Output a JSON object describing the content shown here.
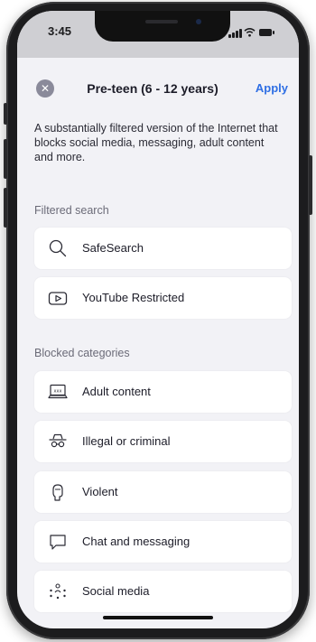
{
  "status": {
    "time": "3:45"
  },
  "header": {
    "title": "Pre-teen (6 - 12 years)",
    "apply_label": "Apply",
    "close_glyph": "✕"
  },
  "description": "A substantially filtered version of the Internet that blocks social media, messaging, adult content and more.",
  "filtered_search": {
    "heading": "Filtered search",
    "items": [
      {
        "label": "SafeSearch",
        "icon": "search-icon"
      },
      {
        "label": "YouTube Restricted",
        "icon": "play-icon"
      }
    ]
  },
  "blocked": {
    "heading": "Blocked categories",
    "items": [
      {
        "label": "Adult content",
        "icon": "xxx-laptop-icon"
      },
      {
        "label": "Illegal or criminal",
        "icon": "spy-icon"
      },
      {
        "label": "Violent",
        "icon": "fist-icon"
      },
      {
        "label": "Chat and messaging",
        "icon": "chat-bubble-icon"
      },
      {
        "label": "Social media",
        "icon": "people-network-icon"
      }
    ]
  },
  "colors": {
    "accent": "#2f6fe4",
    "background": "#f2f2f6",
    "card": "#ffffff"
  }
}
